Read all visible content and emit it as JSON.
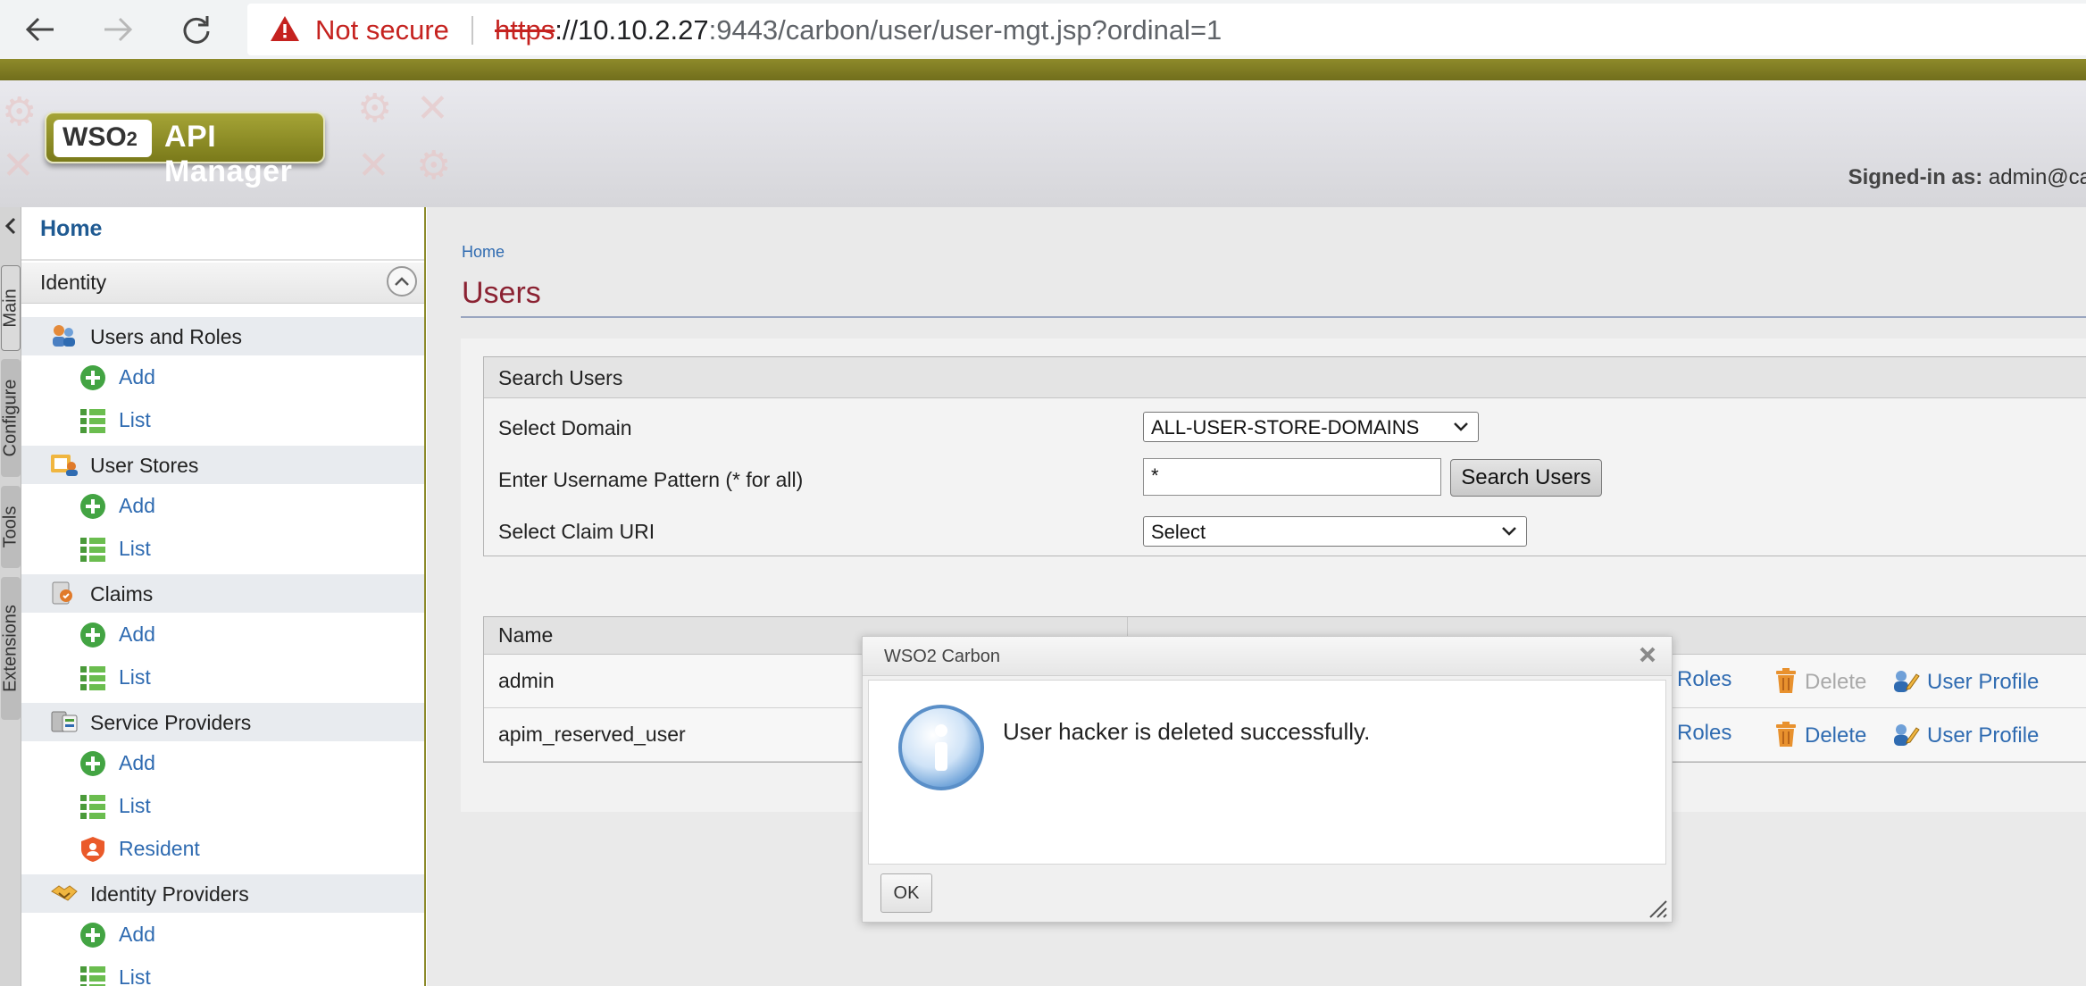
{
  "browser": {
    "security_label": "Not secure",
    "url_scheme": "https",
    "url_host": "://10.10.2.27",
    "url_rest": ":9443/carbon/user/user-mgt.jsp?ordinal=1"
  },
  "header": {
    "logo_wso": "WSO",
    "logo_o": "",
    "logo_product": "API Manager",
    "signed_in_label": "Signed-in as:",
    "signed_in_user": "admin@ca"
  },
  "side_tabs": [
    "Main",
    "Configure",
    "Tools",
    "Extensions"
  ],
  "nav": {
    "home": "Home",
    "section": "Identity",
    "groups": [
      {
        "label": "Users and Roles",
        "icon": "users-roles-icon",
        "items": [
          "Add",
          "List"
        ]
      },
      {
        "label": "User Stores",
        "icon": "user-stores-icon",
        "items": [
          "Add",
          "List"
        ]
      },
      {
        "label": "Claims",
        "icon": "claims-icon",
        "items": [
          "Add",
          "List"
        ]
      },
      {
        "label": "Service Providers",
        "icon": "service-providers-icon",
        "items": [
          "Add",
          "List",
          "Resident"
        ]
      },
      {
        "label": "Identity Providers",
        "icon": "identity-providers-icon",
        "items": [
          "Add",
          "List"
        ]
      }
    ]
  },
  "page": {
    "breadcrumb": "Home",
    "title": "Users"
  },
  "search": {
    "heading": "Search Users",
    "domain_label": "Select Domain",
    "domain_value": "ALL-USER-STORE-DOMAINS",
    "pattern_label": "Enter Username Pattern (* for all)",
    "pattern_value": "*",
    "search_button": "Search Users",
    "claim_label": "Select Claim URI",
    "claim_value": "Select"
  },
  "users_table": {
    "name_header": "Name",
    "rows": [
      {
        "name": "admin",
        "roles": "Roles",
        "delete": "Delete",
        "delete_enabled": false,
        "profile": "User Profile"
      },
      {
        "name": "apim_reserved_user",
        "roles": "Roles",
        "delete": "Delete",
        "delete_enabled": true,
        "profile": "User Profile"
      }
    ]
  },
  "dialog": {
    "title": "WSO2 Carbon",
    "message": "User hacker is deleted successfully.",
    "ok": "OK"
  },
  "colors": {
    "olive": "#8c8a2a",
    "title_red": "#8b2232",
    "link_blue": "#2f6bb1",
    "not_secure_red": "#c5221f"
  }
}
